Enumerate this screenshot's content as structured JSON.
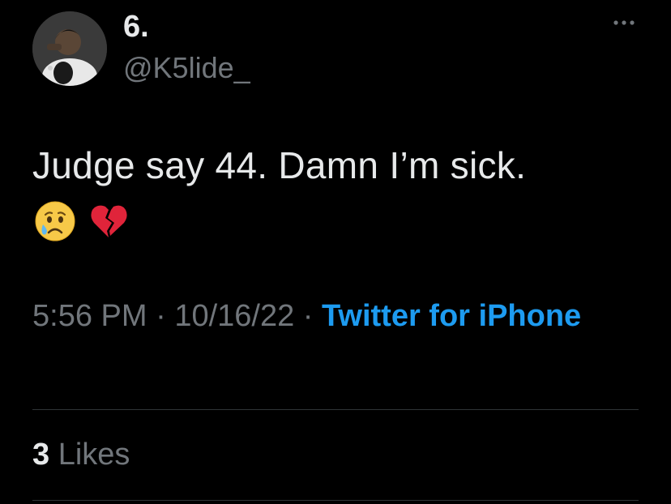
{
  "header": {
    "display_name": "6.",
    "handle": "@K5lide_",
    "more_icon": "more-horizontal-icon"
  },
  "tweet": {
    "text": "Judge say 44. Damn I’m sick.",
    "emojis": [
      "crying-face-emoji",
      "broken-heart-emoji"
    ]
  },
  "meta": {
    "time": "5:56 PM",
    "separator": "·",
    "date": "10/16/22",
    "source": "Twitter for iPhone"
  },
  "stats": {
    "likes_count": "3",
    "likes_label": "Likes"
  },
  "colors": {
    "background": "#000000",
    "primary_text": "#e7e9ea",
    "secondary_text": "#71767b",
    "link": "#1d9bf0",
    "divider": "#2f3336"
  }
}
